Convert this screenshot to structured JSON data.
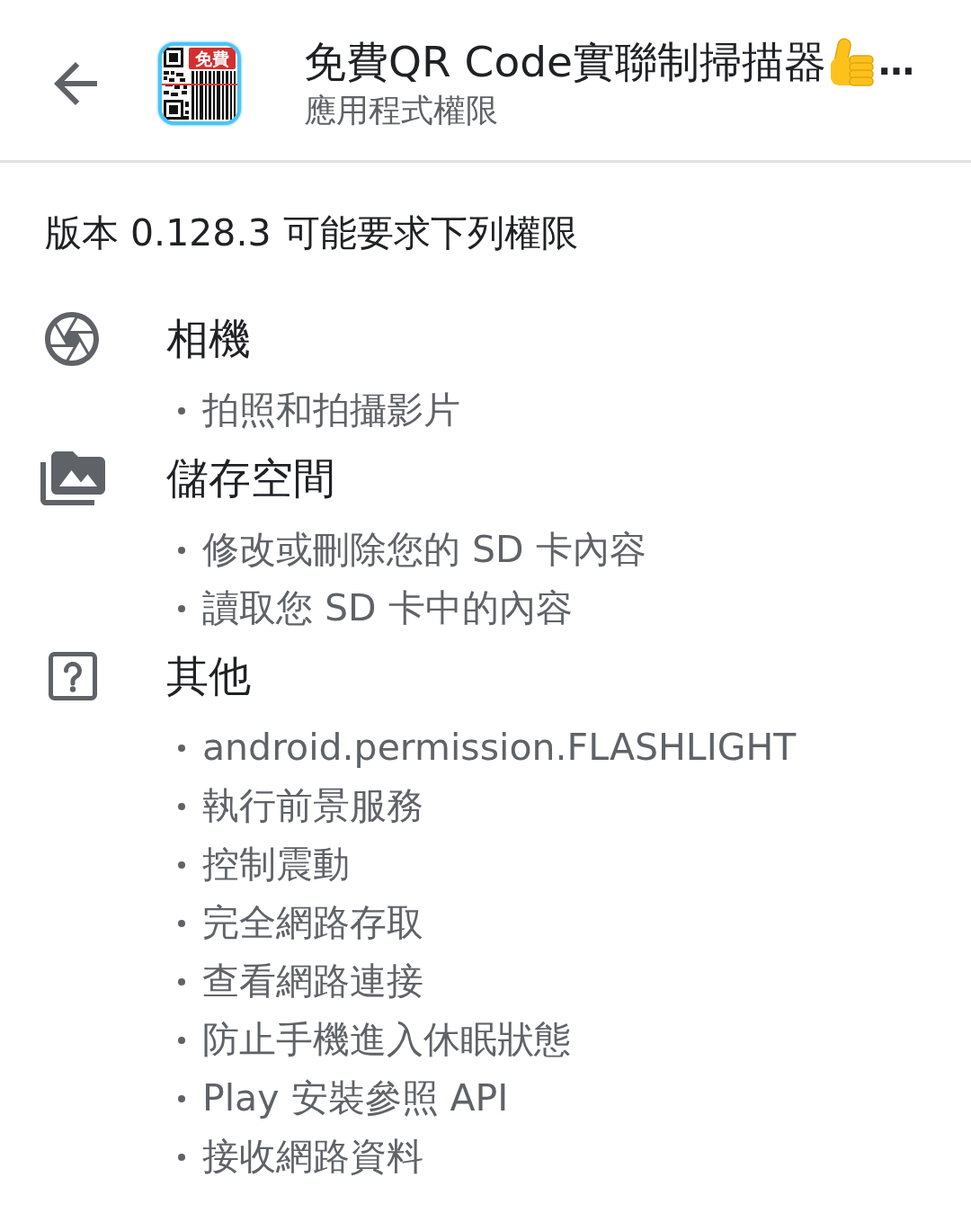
{
  "app_bar": {
    "title": "免費QR Code實聯制掃描器",
    "title_ellipsis": "…",
    "subtitle": "應用程式權限",
    "app_icon_badge": "免費"
  },
  "version_note": "版本 0.128.3 可能要求下列權限",
  "groups": [
    {
      "kind": "camera",
      "title": "相機",
      "items": [
        "拍照和拍攝影片"
      ]
    },
    {
      "kind": "storage",
      "title": "儲存空間",
      "items": [
        "修改或刪除您的 SD 卡內容",
        "讀取您 SD 卡中的內容"
      ]
    },
    {
      "kind": "other",
      "title": "其他",
      "items": [
        "android.permission.FLASHLIGHT",
        "執行前景服務",
        "控制震動",
        "完全網路存取",
        "查看網路連接",
        "防止手機進入休眠狀態",
        "Play 安裝參照 API",
        "接收網路資料"
      ]
    }
  ]
}
